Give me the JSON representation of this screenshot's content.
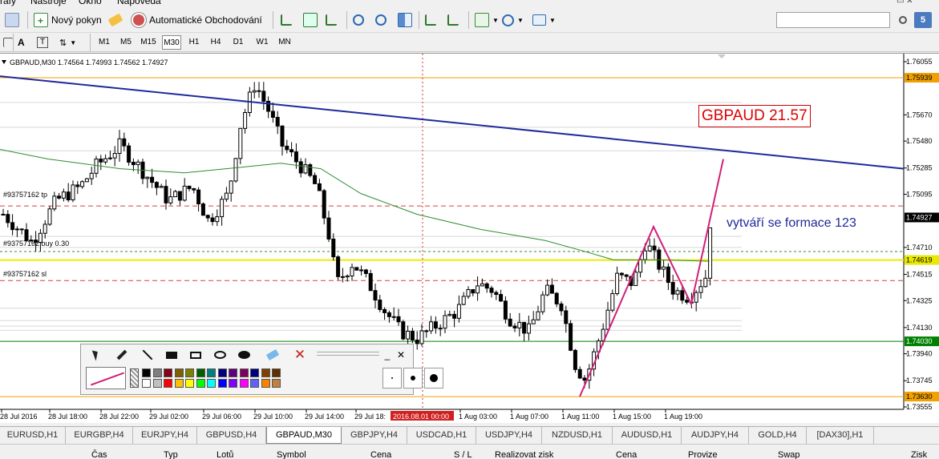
{
  "menubar": {
    "items": [
      "rafy",
      "Nástroje",
      "Okno",
      "Nápověda"
    ]
  },
  "toolbar": {
    "new_order": "Nový pokyn",
    "auto_trading": "Automatické Obchodování",
    "timeframes": [
      "M1",
      "M5",
      "M15",
      "M30",
      "H1",
      "H4",
      "D1",
      "W1",
      "MN"
    ],
    "active_timeframe": "M30",
    "search_button_label": "5"
  },
  "chart": {
    "header": "GBPAUD,M30  1.74564 1.74993 1.74562 1.74927",
    "annotation_title": "GBPAUD 21.57",
    "annotation_note": "vytváří se formace 123",
    "order_labels": [
      "#93757162 tp",
      "#93757162 buy 0.30",
      "#93757162 sl"
    ],
    "price_axis": [
      "1.76055",
      "1.75670",
      "1.75480",
      "1.75285",
      "1.75095",
      "1.74710",
      "1.74515",
      "1.74325",
      "1.74130",
      "1.73940",
      "1.73745",
      "1.73555"
    ],
    "price_highlights": [
      {
        "label": "1.75939",
        "color": "#f0a000"
      },
      {
        "label": "1.74927",
        "color": "#000000"
      },
      {
        "label": "1.74619",
        "color": "#e8e800"
      },
      {
        "label": "1.74030",
        "color": "#008000"
      },
      {
        "label": "1.73630",
        "color": "#f0a000"
      }
    ],
    "time_axis": [
      "28 Jul 2016",
      "28 Jul 18:00",
      "28 Jul 22:00",
      "29 Jul 02:00",
      "29 Jul 06:00",
      "29 Jul 10:00",
      "29 Jul 14:00",
      "29 Jul 18:",
      "1 Aug 03:00",
      "1 Aug 07:00",
      "1 Aug 11:00",
      "1 Aug 15:00",
      "1 Aug 19:00"
    ],
    "time_highlight": "2016.08.01 00:00",
    "colors": {
      "trendline": "#1e2a9a",
      "moving_average": "#2e8b2e",
      "pattern": "#d0207a",
      "support": "#ecec00",
      "level_green": "#008000",
      "level_orange": "#f0a000",
      "sl_line": "#d04040"
    }
  },
  "draw_toolbar": {
    "close": "✕",
    "minimize": "_"
  },
  "symbol_tabs": [
    "EURUSD,H1",
    "EURGBP,H4",
    "EURJPY,H4",
    "GBPUSD,H4",
    "GBPAUD,M30",
    "GBPJPY,H4",
    "USDCAD,H1",
    "USDJPY,H4",
    "NZDUSD,H1",
    "AUDUSD,H1",
    "AUDJPY,H4",
    "GOLD,H4",
    "[DAX30],H1"
  ],
  "active_tab": "GBPAUD,M30",
  "terminal_columns": [
    "Čas",
    "Typ",
    "Lotů",
    "Symbol",
    "Cena",
    "S / L",
    "Realizovat zisk",
    "Cena",
    "Provize",
    "Swap",
    "Zisk"
  ]
}
